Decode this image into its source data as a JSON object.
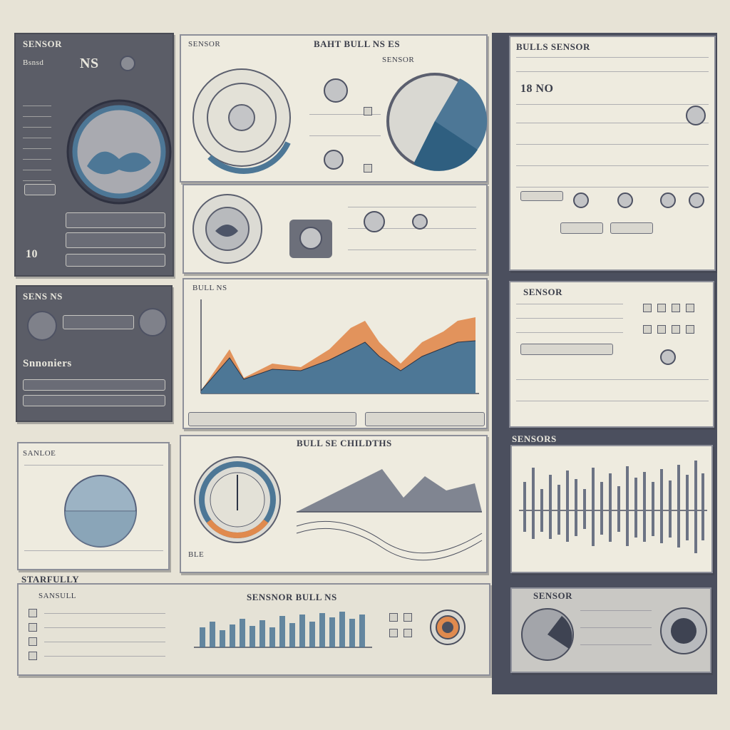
{
  "top_left": {
    "title": "SENSOR",
    "subtitle": "Bsnsd",
    "readout": "NS",
    "value": "10"
  },
  "mid_left": {
    "title": "SENS NS",
    "label": "Snnoniers"
  },
  "lower_left": {
    "title": "SANLOE"
  },
  "bottom_bar_label": "STARFULLY",
  "top_center": {
    "title": "SENSOR",
    "header": "BAHT BULL NS ES",
    "subheader": "SENSOR"
  },
  "center_chart_header": "BULL NS",
  "center_bottom": {
    "title": "BULL SE CHILDTHS",
    "label": "BLE"
  },
  "bottom_center": {
    "title": "SANSULL",
    "chart_title": "SENSNOR BULL NS"
  },
  "right_top": {
    "title": "BULLS SENSOR",
    "value": "18 NO"
  },
  "right_mid": {
    "title": "SENSOR"
  },
  "right_lower": {
    "title": "SENSORS"
  },
  "right_bottom": {
    "title": "SENSOR"
  },
  "icons": [
    "gauge-icon",
    "dial-icon",
    "knob-icon",
    "sensor-icon"
  ],
  "colors": {
    "accent_blue": "#4d7796",
    "accent_orange": "#e08a4e",
    "panel": "#eeebdf",
    "dark_panel": "#5b5d67"
  }
}
